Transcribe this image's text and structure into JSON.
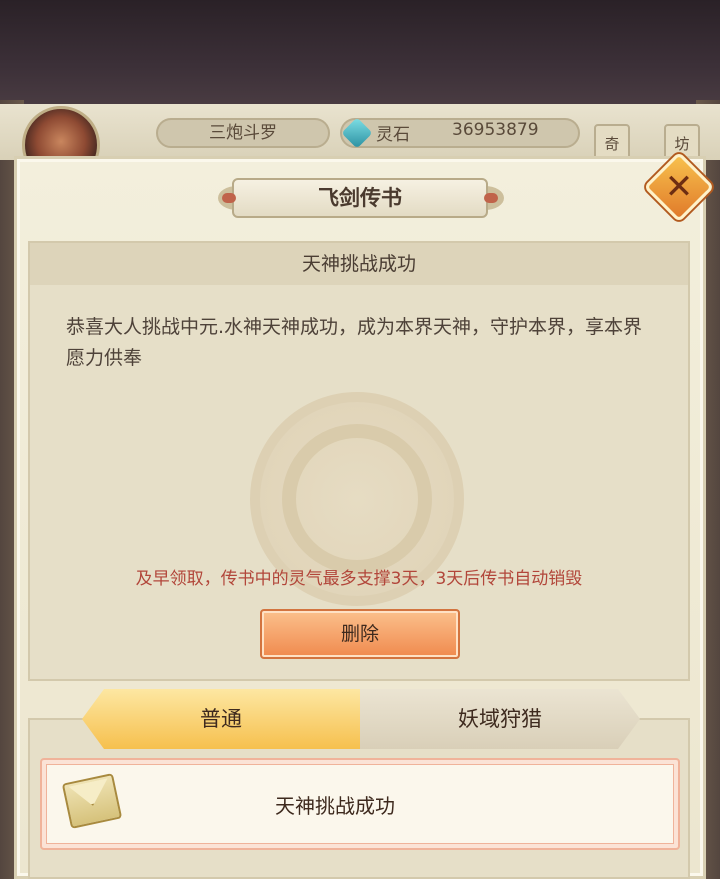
{
  "hud": {
    "player_name": "三炮斗罗",
    "resource_label": "灵石",
    "resource_value": "36953879",
    "side_buttons": [
      "奇",
      "坊"
    ]
  },
  "modal": {
    "title": "飞剑传书",
    "letter": {
      "subject": "天神挑战成功",
      "body": "恭喜大人挑战中元.水神天神成功，成为本界天神，守护本界，享本界愿力供奉",
      "warning": "及早领取，传书中的灵气最多支撑3天，3天后传书自动销毁",
      "delete_label": "删除"
    },
    "tabs": [
      {
        "label": "普通",
        "active": true
      },
      {
        "label": "妖域狩猎",
        "active": false
      }
    ],
    "mail_list": [
      {
        "title": "天神挑战成功",
        "icon": "envelope-icon"
      }
    ]
  },
  "colors": {
    "warning_text": "#b2463a",
    "active_tab": "#f6c04e",
    "delete_button": "#f08a4e",
    "close_button": "#e07a2a"
  }
}
